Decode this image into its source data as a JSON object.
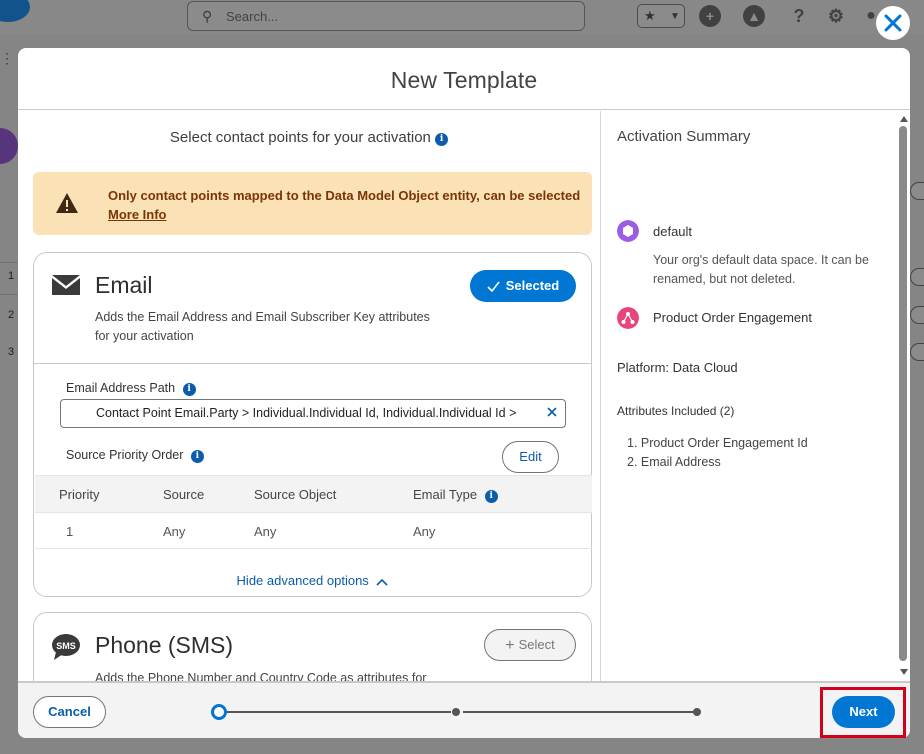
{
  "background": {
    "search_placeholder": "Search...",
    "row_numbers": [
      "1",
      "2",
      "3"
    ]
  },
  "modal": {
    "title": "New Template",
    "instruction": "Select contact points for your activation",
    "warning": {
      "text": "Only contact points mapped to the Data Model Object entity, can be selected",
      "link": "More Info"
    },
    "email": {
      "title": "Email",
      "selected_label": "Selected",
      "description": "Adds the Email Address and Email Subscriber Key attributes for your activation",
      "path_label": "Email Address Path",
      "path_value": "Contact Point Email.Party > Individual.Individual Id, Individual.Individual Id >",
      "priority_label": "Source Priority Order",
      "edit_label": "Edit",
      "table": {
        "headers": [
          "Priority",
          "Source",
          "Source Object",
          "Email Type"
        ],
        "rows": [
          [
            "1",
            "Any",
            "Any",
            "Any"
          ]
        ]
      },
      "advanced_link": "Hide advanced options"
    },
    "phone": {
      "title": "Phone (SMS)",
      "select_label": "Select",
      "description": "Adds the Phone Number and Country Code as attributes for"
    },
    "summary": {
      "title": "Activation Summary",
      "space_name": "default",
      "space_desc": "Your org's default data space. It can be renamed, but not deleted.",
      "entity_name": "Product Order Engagement",
      "platform": "Platform: Data Cloud",
      "attributes_title": "Attributes Included (2)",
      "attributes": [
        "1. Product Order Engagement Id",
        "2. Email Address"
      ]
    },
    "footer": {
      "cancel_label": "Cancel",
      "next_label": "Next",
      "steps_total": 3,
      "current_step": 1
    }
  },
  "colors": {
    "brand_blue": "#0176d3",
    "link_blue": "#0b5cab",
    "warning_bg": "#fbe1b6",
    "warning_text": "#7a3505",
    "highlight_red": "#d0021b",
    "data_space_purple": "#9b5de5",
    "entity_pink": "#e8457a"
  }
}
